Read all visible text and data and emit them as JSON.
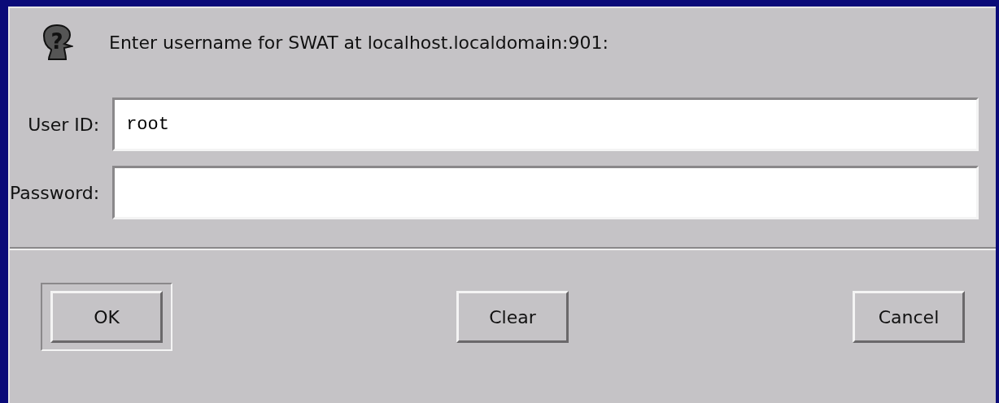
{
  "icon_glyph": "?",
  "prompt": "Enter username for SWAT at localhost.localdomain:901:",
  "fields": [
    {
      "label": "User ID:",
      "value": "root"
    },
    {
      "label": "Password:"
    }
  ],
  "buttons": [
    {
      "label": "OK",
      "default": true
    },
    {
      "label": "Clear",
      "default": false
    },
    {
      "label": "Cancel",
      "default": false
    }
  ]
}
